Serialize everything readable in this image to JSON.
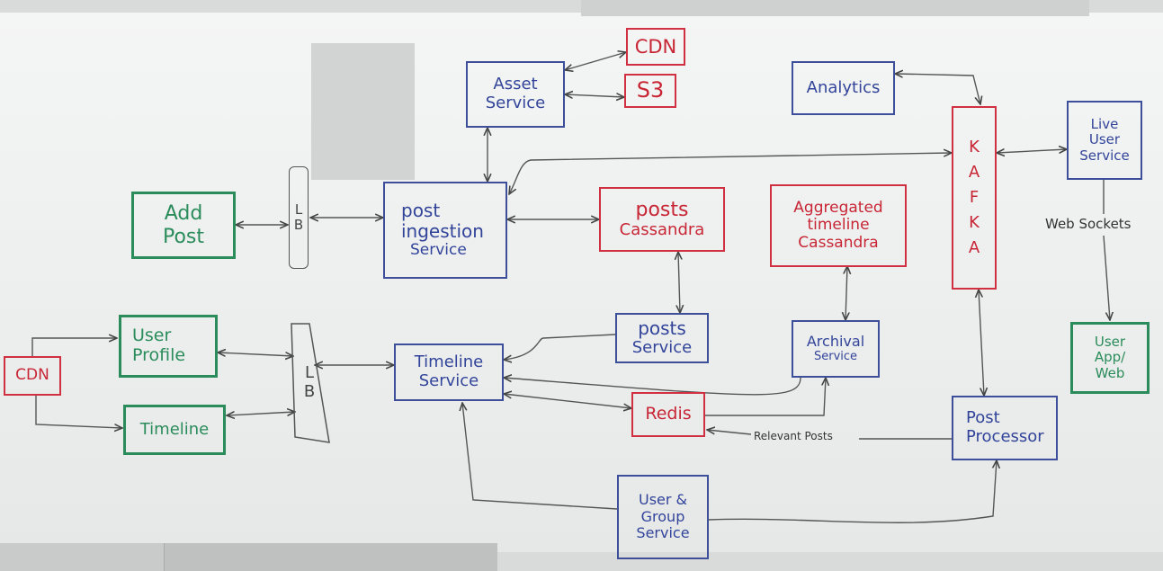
{
  "nodes": {
    "add_post": [
      "Add",
      "Post"
    ],
    "lb_top": [
      "L",
      "B"
    ],
    "post_ingestion": [
      "post",
      "ingestion",
      "Service"
    ],
    "asset_service": [
      "Asset",
      "Service"
    ],
    "cdn_top": "CDN",
    "s3": "S3",
    "posts_cassandra": [
      "posts",
      "Cassandra"
    ],
    "aggregated_timeline": [
      "Aggregated",
      "timeline",
      "Cassandra"
    ],
    "analytics": "Analytics",
    "kafka": [
      "K",
      "A",
      "F",
      "K",
      "A"
    ],
    "live_user_service": [
      "Live",
      "User",
      "Service"
    ],
    "user_app_web": [
      "User",
      "App/",
      "Web"
    ],
    "cdn_left": "CDN",
    "user_profile": [
      "User",
      "Profile"
    ],
    "timeline": "Timeline",
    "lb_bottom": [
      "L",
      "B"
    ],
    "timeline_service": [
      "Timeline",
      "Service"
    ],
    "posts_service": [
      "posts",
      "Service"
    ],
    "archival_service": [
      "Archival",
      "Service"
    ],
    "redis": "Redis",
    "post_processor": [
      "Post",
      "Processor"
    ],
    "user_group_service": [
      "User &",
      "Group",
      "Service"
    ]
  },
  "labels": {
    "websockets": "Web Sockets",
    "relevant_posts": "Relevant Posts"
  },
  "colors": {
    "service_blue": "#3d4f9b",
    "store_red": "#d0303f",
    "client_green": "#2a8c5a",
    "wire": "#555555"
  }
}
